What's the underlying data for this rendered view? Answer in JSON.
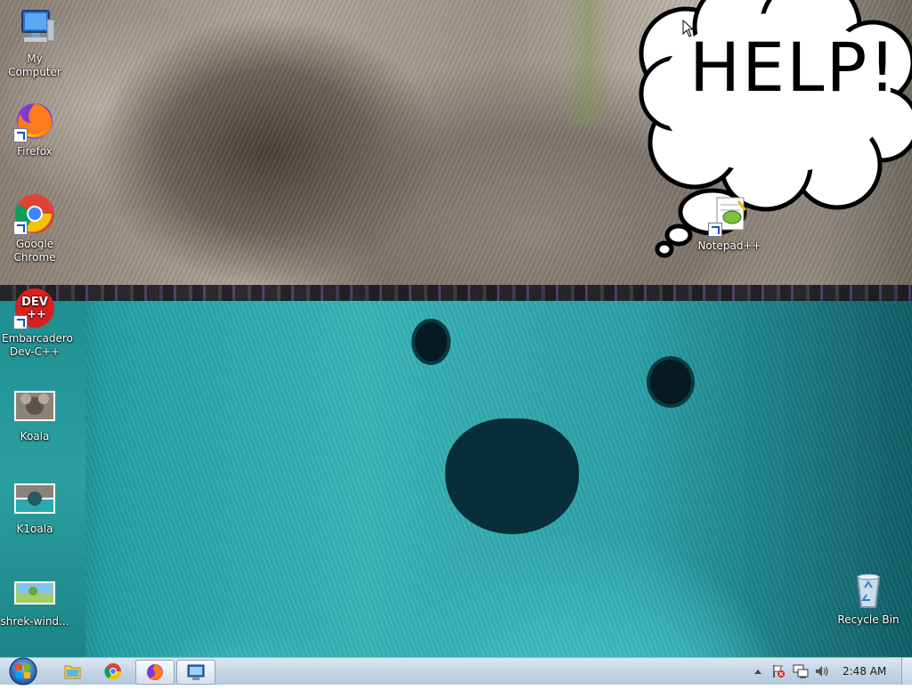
{
  "desktop": {
    "bubble_text": "HELP!",
    "icons": [
      {
        "label": "My Computer"
      },
      {
        "label": "Firefox"
      },
      {
        "label": "Google Chrome"
      },
      {
        "label": "Embarcadero Dev-C++"
      },
      {
        "label": "Koala"
      },
      {
        "label": "K1oala"
      },
      {
        "label": "shrek-wind..."
      },
      {
        "label": "Notepad++"
      },
      {
        "label": "Recycle Bin"
      }
    ],
    "devcpp_icon_text": "DEV\n++"
  },
  "taskbar": {
    "pinned": [
      {
        "icon": "start-orb-icon"
      },
      {
        "icon": "explorer-folder-icon"
      },
      {
        "icon": "chrome-icon"
      },
      {
        "icon": "firefox-icon"
      },
      {
        "icon": "remote-desktop-icon"
      }
    ],
    "clock": "2:48 AM",
    "tray_icons": [
      "show-hidden-icons-arrow",
      "action-center-flag-icon",
      "network-icon",
      "volume-icon"
    ]
  },
  "colors": {
    "help_bubble": "#ffffff",
    "wallpaper_top": "#9b9287",
    "wallpaper_bottom": "#39b5b8",
    "taskbar": "#c5d5e6"
  }
}
